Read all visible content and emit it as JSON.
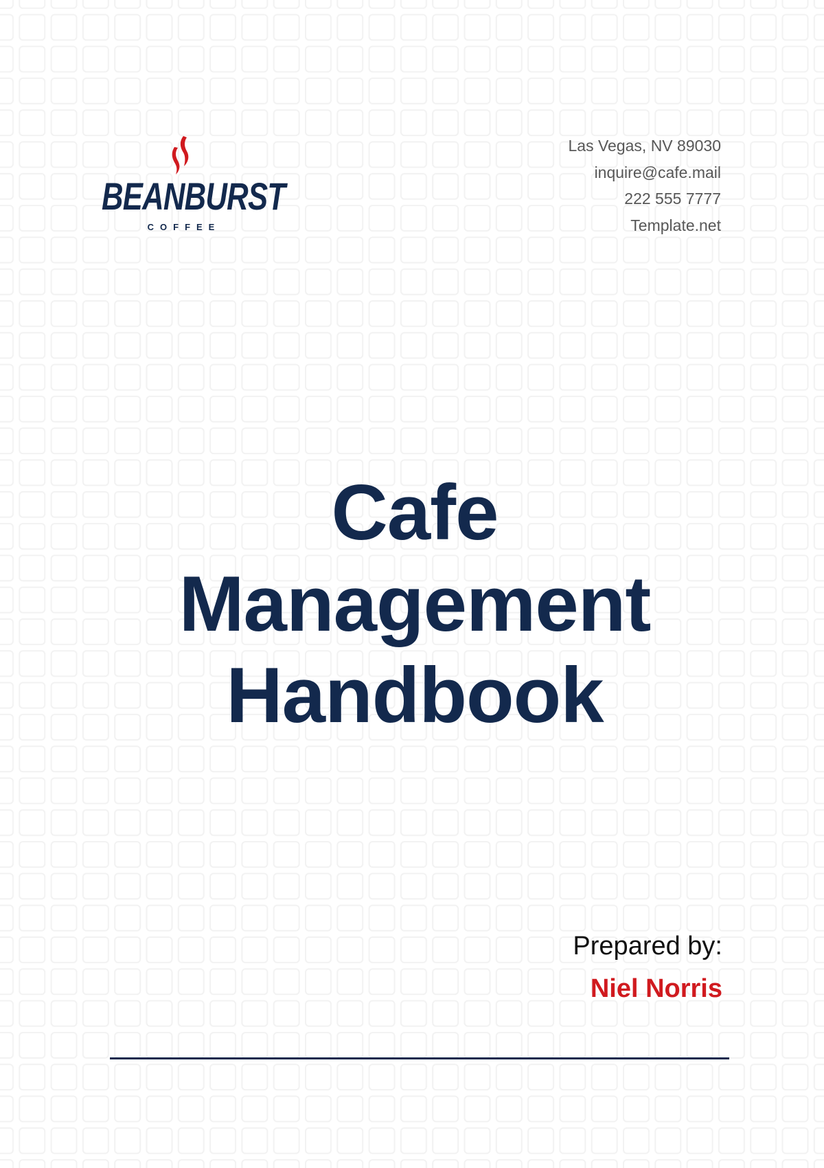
{
  "document": {
    "type": "cover-page"
  },
  "brand": {
    "name": "BEANBURST",
    "tagline": "COFFEE",
    "logo_icon": "steam-icon",
    "colors": {
      "navy": "#13294d",
      "red": "#d01a1f",
      "text_gray": "#575757",
      "grid": "#f2f2f2"
    }
  },
  "contact": {
    "address": "Las Vegas, NV 89030",
    "email": "inquire@cafe.mail",
    "phone": "222 555 7777",
    "website": "Template.net"
  },
  "title": {
    "line1": "Cafe",
    "line2": "Management",
    "line3": "Handbook"
  },
  "prepared": {
    "label": "Prepared by:",
    "name": "Niel Norris"
  }
}
